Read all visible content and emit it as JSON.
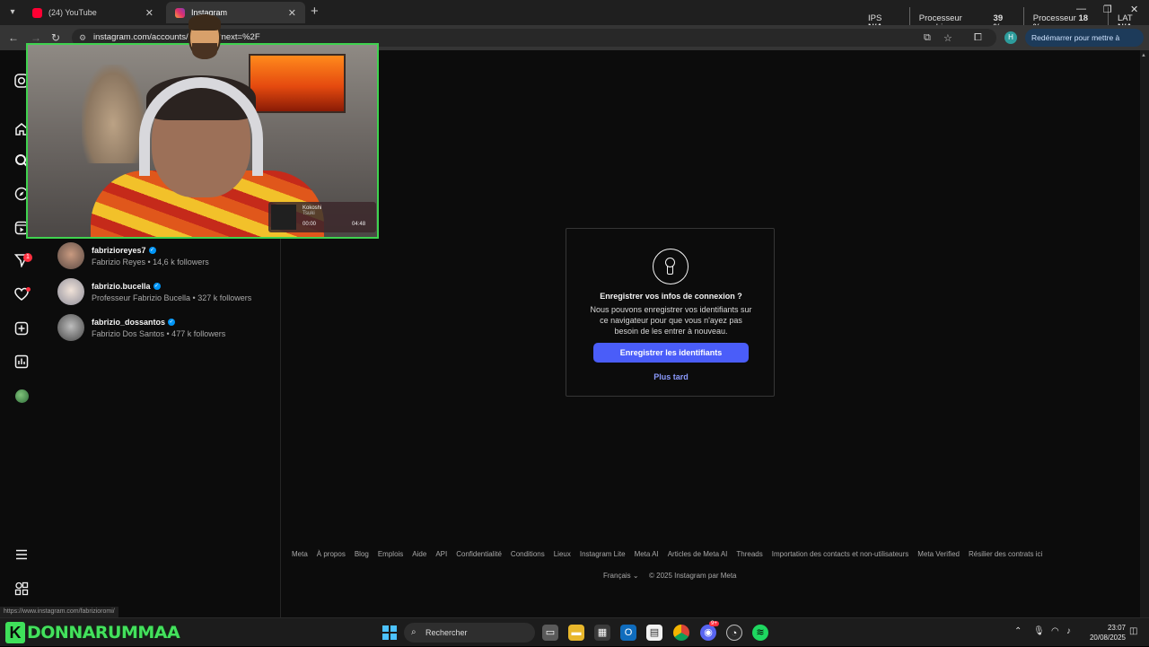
{
  "browser": {
    "tabs": [
      {
        "title": "(24) YouTube",
        "favicon": "youtube-icon",
        "active": false
      },
      {
        "title": "Instagram",
        "favicon": "instagram-icon",
        "active": true
      }
    ],
    "url": "instagram.com/accounts/onetap/?next=%2F",
    "restart_label": "Redémarrer pour mettre à jour",
    "profile_initial": "H",
    "status_url": "https://www.instagram.com/fabrizioromi/"
  },
  "perf_overlay": {
    "ips_label": "IPS",
    "ips_value": "N/A",
    "gpu_label": "Processeur graphique",
    "gpu_value": "39 %",
    "cpu_label": "Processeur",
    "cpu_value": "18 %",
    "lat_label": "LAT",
    "lat_value": "N/A"
  },
  "sidebar": {
    "items": [
      {
        "name": "instagram-logo-icon"
      },
      {
        "name": "home-icon"
      },
      {
        "name": "search-icon"
      },
      {
        "name": "explore-icon"
      },
      {
        "name": "reels-icon"
      },
      {
        "name": "messages-icon",
        "badge": "1"
      },
      {
        "name": "notifications-icon"
      },
      {
        "name": "create-icon"
      },
      {
        "name": "dashboard-icon"
      },
      {
        "name": "profile-icon"
      },
      {
        "name": "more-menu-icon"
      },
      {
        "name": "also-from-meta-icon"
      }
    ]
  },
  "search_results": [
    {
      "username": "fabrizioreyes7",
      "full_name": "Fabrizio Reyes • 14,6 k followers",
      "verified": true
    },
    {
      "username": "fabrizio.bucella",
      "full_name": "Professeur Fabrizio Bucella • 327 k followers",
      "verified": true
    },
    {
      "username": "fabrizio_dossantos",
      "full_name": "Fabrizio Dos Santos • 477 k followers",
      "verified": true
    }
  ],
  "save_login_modal": {
    "title": "Enregistrer vos infos de connexion ?",
    "body": "Nous pouvons enregistrer vos identifiants sur ce navigateur pour que vous n'ayez pas besoin de les entrer à nouveau.",
    "primary_button": "Enregistrer les identifiants",
    "secondary_button": "Plus tard"
  },
  "footer": {
    "links": [
      "Meta",
      "À propos",
      "Blog",
      "Emplois",
      "Aide",
      "API",
      "Confidentialité",
      "Conditions",
      "Lieux",
      "Instagram Lite",
      "Meta AI",
      "Articles de Meta AI",
      "Threads",
      "Importation des contacts et non-utilisateurs",
      "Meta Verified",
      "Résilier des contrats ici"
    ],
    "language": "Français",
    "copyright": "© 2025 Instagram par Meta"
  },
  "webcam_overlay": {
    "now_playing_title": "Kokoshi",
    "now_playing_artist": "Tsuki",
    "time_elapsed": "00:00",
    "time_total": "04:48"
  },
  "stream_branding": {
    "badge": "K",
    "name": "DONNARUMMAA"
  },
  "taskbar": {
    "search_placeholder": "Rechercher",
    "discord_badge": "9+",
    "time": "23:07",
    "date": "20/08/2025"
  },
  "colors": {
    "instagram_bg": "#0c0c0c",
    "primary_button": "#4a5df9",
    "link_blue": "#8c9bff",
    "badge_red": "#ff3040",
    "webcam_border": "#3fd24f"
  }
}
